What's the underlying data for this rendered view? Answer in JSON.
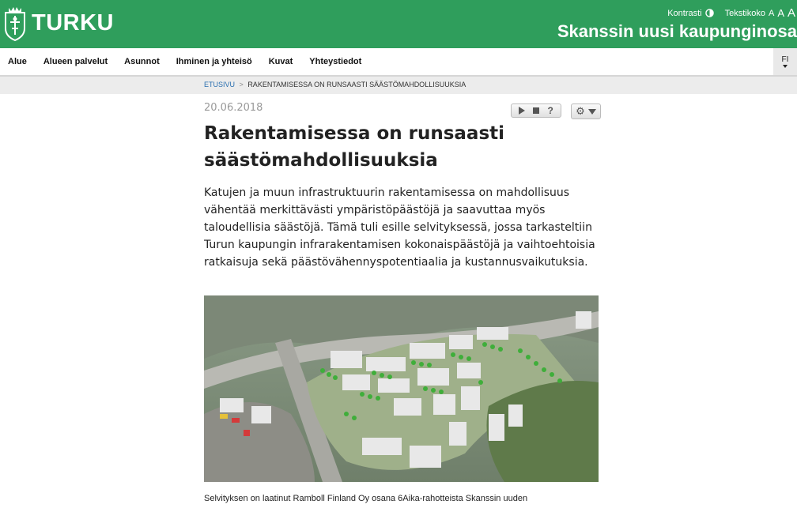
{
  "header": {
    "logo_text": "TURKU",
    "contrast_label": "Kontrasti",
    "textsize_label": "Tekstikoko",
    "size_letters": [
      "A",
      "A",
      "A"
    ],
    "site_title": "Skanssin uusi kaupunginosa"
  },
  "nav": {
    "items": [
      {
        "label": "Alue"
      },
      {
        "label": "Alueen palvelut"
      },
      {
        "label": "Asunnot"
      },
      {
        "label": "Ihminen ja yhteisö"
      },
      {
        "label": "Kuvat"
      },
      {
        "label": "Yhteystiedot"
      }
    ],
    "language": "FI"
  },
  "breadcrumb": {
    "home": "ETUSIVU",
    "separator": ">",
    "current": "RAKENTAMISESSA ON RUNSAASTI SÄÄSTÖMAHDOLLISUUKSIA"
  },
  "article": {
    "date": "20.06.2018",
    "player": {
      "help": "?"
    },
    "title": "Rakentamisessa on runsaasti säästömahdollisuuksia",
    "lead": "Katujen ja muun infrastruktuurin rakentamisessa on mahdollisuus vähentää merkittävästi ympäristöpäästöjä ja saavuttaa myös taloudellisia säästöjä. Tämä tuli esille selvityksessä, jossa tarkasteltiin Turun kaupungin infrarakentamisen kokonaispäästöjä ja vaihtoehtoisia ratkaisuja sekä päästövähennyspotentiaalia ja kustannusvaikutuksia.",
    "caption": "Selvityksen on laatinut Ramboll Finland Oy osana 6Aika-rahotteista Skanssin uuden"
  },
  "colors": {
    "brand_green": "#2f9e5c",
    "link_blue": "#2a6fb0"
  }
}
